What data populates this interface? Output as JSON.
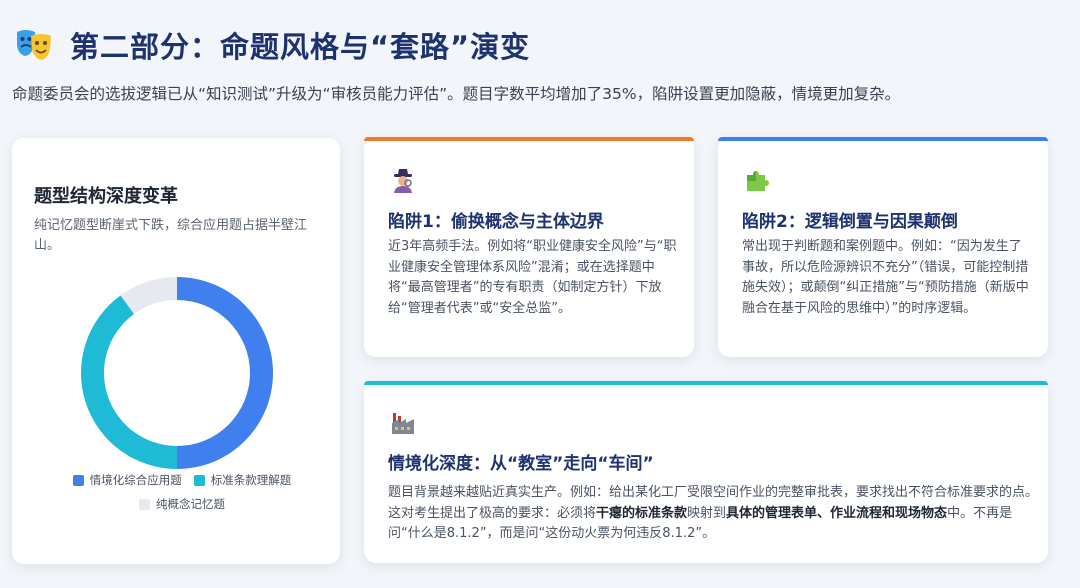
{
  "header": {
    "icon": "theater-masks-icon",
    "title": "第二部分：命题风格与“套路”演变",
    "subtitle": "命题委员会的选拔逻辑已从“知识测试”升级为“审核员能力评估”。题目字数平均增加了35%，陷阱设置更加隐蔽，情境更加复杂。"
  },
  "chart_card": {
    "title": "题型结构深度变革",
    "description": "纯记忆题型断崖式下跌，综合应用题占据半壁江山。",
    "chart_data": {
      "type": "pie",
      "donut": true,
      "categories": [
        "情境化综合应用题",
        "标准条款理解题",
        "纯概念记忆题"
      ],
      "values": [
        50,
        40,
        10
      ],
      "colors": [
        "#3f7fee",
        "#1fbad5",
        "#e6eaf0"
      ],
      "legend_position": "bottom"
    }
  },
  "traps": [
    {
      "icon": "detective-icon",
      "accent": "#ec7a2a",
      "title": "陷阱1：偷换概念与主体边界",
      "body": "近3年高频手法。例如将“职业健康安全风险”与“职业健康安全管理体系风险”混淆；或在选择题中将“最高管理者”的专有职责（如制定方针）下放给“管理者代表”或“安全总监”。"
    },
    {
      "icon": "puzzle-icon",
      "accent": "#3f7fee",
      "title": "陷阱2：逻辑倒置与因果颠倒",
      "body": "常出现于判断题和案例题中。例如：“因为发生了事故，所以危险源辨识不充分”（错误，可能控制措施失效）；或颠倒“纠正措施”与“预防措施（新版中融合在基于风险的思维中）”的时序逻辑。"
    }
  ],
  "scene": {
    "icon": "factory-icon",
    "accent": "#1fbad5",
    "title": "情境化深度：从“教室”走向“车间”",
    "body_1": "题目背景越来越贴近真实生产。例如：给出某化工厂受限空间作业的完整审批表，要求找出不符合标准要求的点。这对考生提出了极高的要求：必须将",
    "highlight_1": "干瘪的标准条款",
    "body_2": "映射到",
    "highlight_2": "具体的管理表单、作业流程和现场物态",
    "body_3": "中。不再是问“什么是8.1.2”，而是问“这份动火票为何违反8.1.2”。"
  }
}
